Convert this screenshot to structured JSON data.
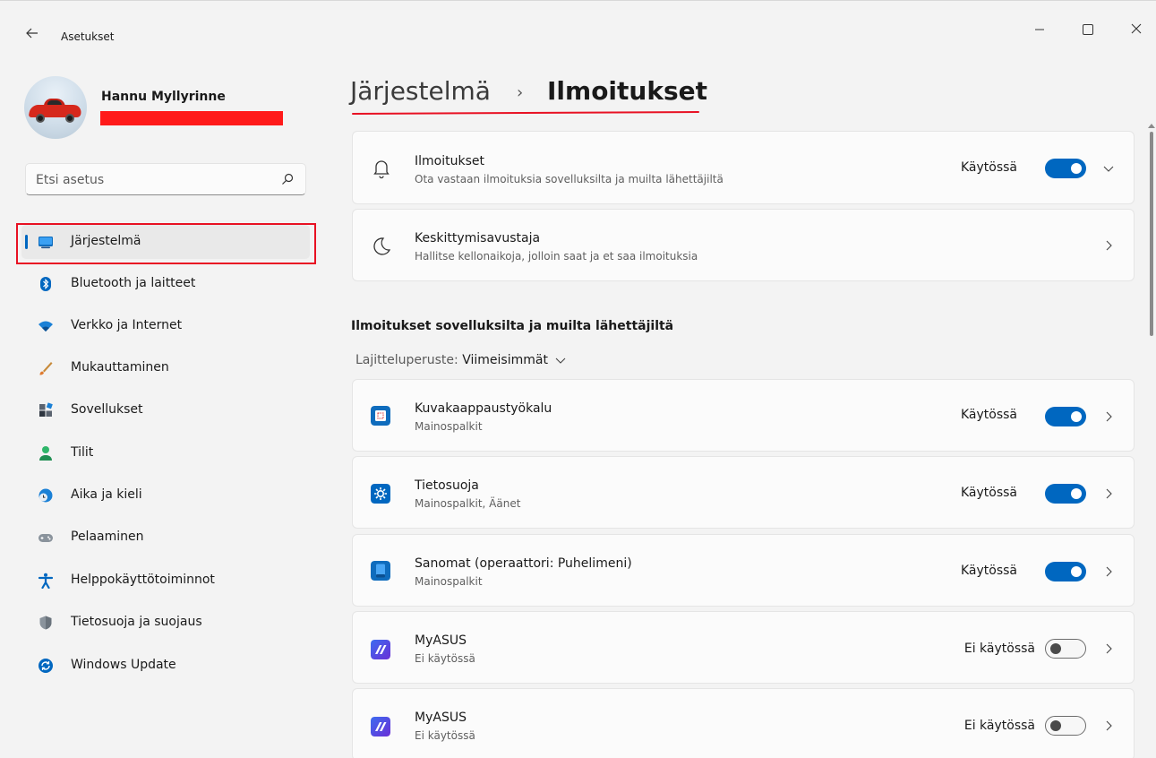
{
  "window": {
    "title": "Asetukset",
    "back_icon": "arrow-left-icon",
    "controls": [
      "minimize-icon",
      "maximize-icon",
      "close-icon"
    ]
  },
  "profile": {
    "name": "Hannu Myllyrinne"
  },
  "search": {
    "placeholder": "Etsi asetus",
    "icon": "search-icon"
  },
  "nav": {
    "items": [
      {
        "label": "Järjestelmä",
        "icon": "system-monitor-icon",
        "active": true
      },
      {
        "label": "Bluetooth ja laitteet",
        "icon": "bluetooth-icon"
      },
      {
        "label": "Verkko ja Internet",
        "icon": "wifi-icon"
      },
      {
        "label": "Mukauttaminen",
        "icon": "brush-icon"
      },
      {
        "label": "Sovellukset",
        "icon": "apps-icon"
      },
      {
        "label": "Tilit",
        "icon": "account-icon"
      },
      {
        "label": "Aika ja kieli",
        "icon": "globe-clock-icon"
      },
      {
        "label": "Pelaaminen",
        "icon": "gamepad-icon"
      },
      {
        "label": "Helppokäyttötoiminnot",
        "icon": "accessibility-icon"
      },
      {
        "label": "Tietosuoja ja suojaus",
        "icon": "shield-icon"
      },
      {
        "label": "Windows Update",
        "icon": "windows-update-icon"
      }
    ]
  },
  "breadcrumb": {
    "parent": "Järjestelmä",
    "separator": "›",
    "current": "Ilmoitukset"
  },
  "settings": [
    {
      "title": "Ilmoitukset",
      "subtitle": "Ota vastaan ilmoituksia sovelluksilta ja muilta lähettäjiltä",
      "icon": "bell-icon",
      "status": "Käytössä",
      "toggle_on": true,
      "chevron": "chevron-down-icon"
    },
    {
      "title": "Keskittymisavustaja",
      "subtitle": "Hallitse kellonaikoja, jolloin saat ja et saa ilmoituksia",
      "icon": "moon-icon",
      "chevron": "chevron-right-icon"
    }
  ],
  "section": {
    "title": "Ilmoitukset sovelluksilta ja muilta lähettäjiltä",
    "sort_label": "Lajitteluperuste:",
    "sort_value": "Viimeisimmät"
  },
  "apps": [
    {
      "name": "Kuvakaappaustyökalu",
      "detail": "Mainospalkit",
      "icon": "snipping-tool-icon",
      "status": "Käytössä",
      "on": true,
      "color": "#0f6cbd"
    },
    {
      "name": "Tietosuoja",
      "detail": "Mainospalkit, Äänet",
      "icon": "privacy-gear-icon",
      "status": "Käytössä",
      "on": true,
      "color": "#0067c0"
    },
    {
      "name": "Sanomat (operaattori: Puhelimeni)",
      "detail": "Mainospalkit",
      "icon": "messages-icon",
      "status": "Käytössä",
      "on": true,
      "color": "#0f6cbd"
    },
    {
      "name": "MyASUS",
      "detail": "Ei käytössä",
      "icon": "myasus-icon",
      "status": "Ei käytössä",
      "on": false,
      "color": "#4b3fe0"
    },
    {
      "name": "MyASUS",
      "detail": "Ei käytössä",
      "icon": "myasus-icon",
      "status": "Ei käytössä",
      "on": false,
      "color": "#4b3fe0"
    }
  ],
  "colors": {
    "accent": "#0067c0",
    "annotation_red": "#e81123",
    "background": "#f3f3f3",
    "card": "#fbfbfb"
  }
}
